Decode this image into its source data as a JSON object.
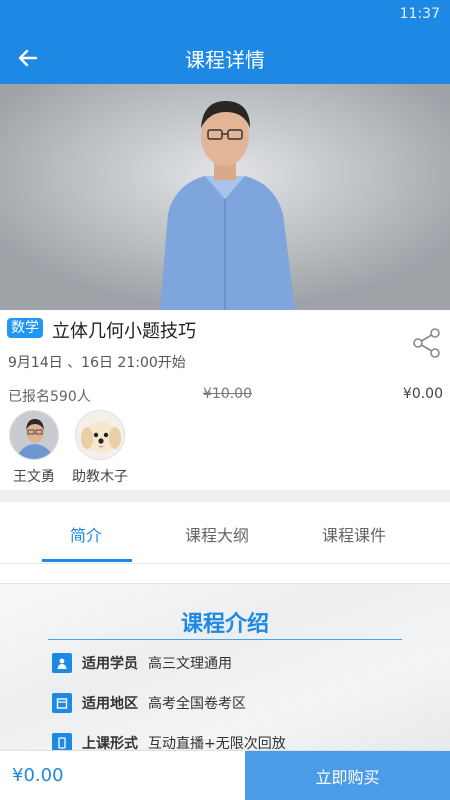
{
  "status_bar": {
    "time": "11:37"
  },
  "app_bar": {
    "title": "课程详情",
    "back_icon": "arrow-left-icon"
  },
  "hero": {
    "image": "teacher-photo"
  },
  "course": {
    "subject": "数学",
    "title": "立体几何小题技巧",
    "schedule": "9月14日 、16日 21:00开始",
    "enrolled": "已报名590人",
    "original_price": "¥10.00",
    "price": "¥0.00",
    "share_icon": "share-icon"
  },
  "teachers": [
    {
      "name": "王文勇",
      "avatar": "teacher-avatar"
    },
    {
      "name": "助教木子",
      "avatar": "dog-avatar"
    }
  ],
  "tabs": [
    {
      "label": "简介",
      "active": true
    },
    {
      "label": "课程大纲",
      "active": false
    },
    {
      "label": "课程课件",
      "active": false
    }
  ],
  "intro": {
    "title": "课程介绍",
    "rows": [
      {
        "icon": "person-icon",
        "label": "适用学员",
        "value": "高三文理通用"
      },
      {
        "icon": "calendar-icon",
        "label": "适用地区",
        "value": "高考全国卷考区"
      },
      {
        "icon": "phone-icon",
        "label": "上课形式",
        "value": "互动直播+无限次回放"
      }
    ]
  },
  "bottom_bar": {
    "price": "¥0.00",
    "buy_label": "立即购买"
  },
  "colors": {
    "primary": "#1e88e5",
    "badge": "#2196f3",
    "buy_button": "#4a9be8"
  }
}
